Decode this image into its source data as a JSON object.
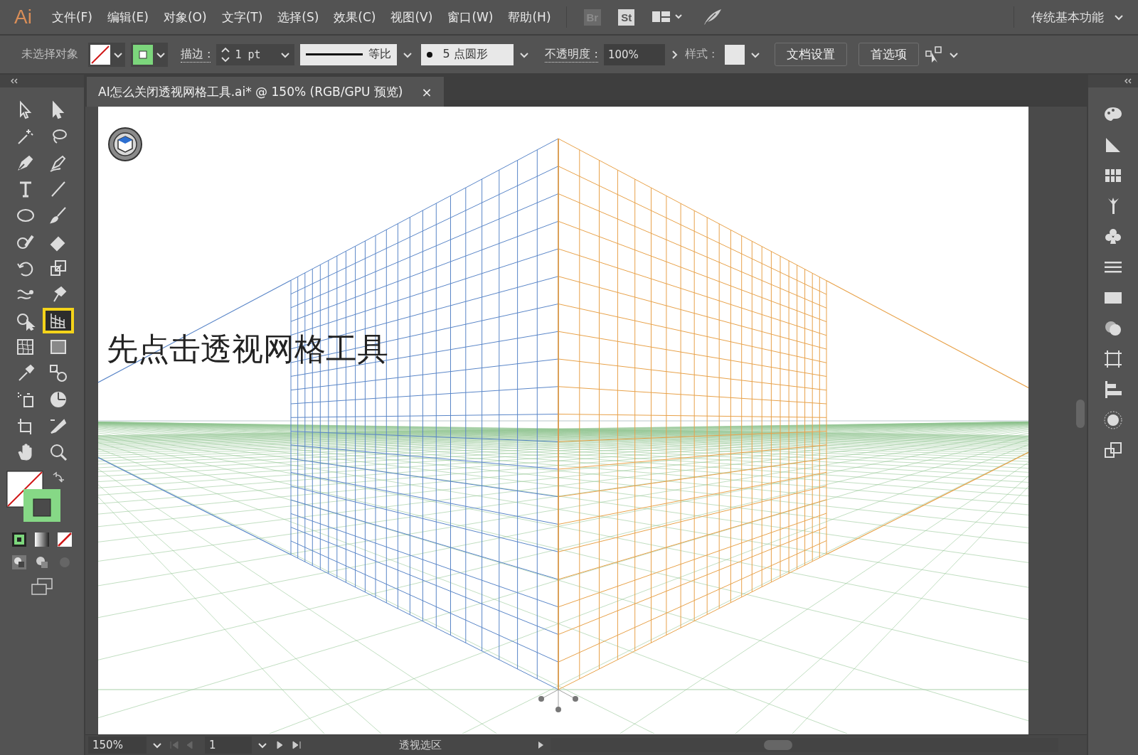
{
  "app_logo": "Ai",
  "menu": [
    "文件(F)",
    "编辑(E)",
    "对象(O)",
    "文字(T)",
    "选择(S)",
    "效果(C)",
    "视图(V)",
    "窗口(W)",
    "帮助(H)"
  ],
  "bridge_button": "Br",
  "stock_button": "St",
  "workspace": "传统基本功能",
  "control_bar": {
    "selection": "未选择对象",
    "stroke_label": "描边 :",
    "stroke_weight": "1 pt",
    "stroke_profile": "等比",
    "brush": "5 点圆形",
    "opacity_label": "不透明度 :",
    "opacity": "100%",
    "style_label": "样式 :",
    "buttons": [
      "文档设置",
      "首选项"
    ]
  },
  "document_tab": {
    "title": "AI怎么关闭透视网格工具.ai* @ 150% (RGB/GPU 预览)",
    "close": "×"
  },
  "tools": [
    {
      "kind": "selection",
      "selected": false
    },
    {
      "kind": "direct",
      "selected": false
    },
    {
      "kind": "wand",
      "selected": false
    },
    {
      "kind": "lasso",
      "selected": false
    },
    {
      "kind": "pen",
      "selected": false
    },
    {
      "kind": "curvature",
      "selected": false
    },
    {
      "kind": "type",
      "selected": false
    },
    {
      "kind": "line",
      "selected": false
    },
    {
      "kind": "ellipse",
      "selected": false
    },
    {
      "kind": "brush",
      "selected": false
    },
    {
      "kind": "shaper",
      "selected": false
    },
    {
      "kind": "eraser",
      "selected": false
    },
    {
      "kind": "rotate",
      "selected": false
    },
    {
      "kind": "scale",
      "selected": false
    },
    {
      "kind": "width",
      "selected": false
    },
    {
      "kind": "puppet",
      "selected": false
    },
    {
      "kind": "shapebuilder",
      "selected": false
    },
    {
      "kind": "perspective",
      "selected": true
    },
    {
      "kind": "mesh",
      "selected": false
    },
    {
      "kind": "gradient",
      "selected": false
    },
    {
      "kind": "eyedropper",
      "selected": false
    },
    {
      "kind": "blend",
      "selected": false
    },
    {
      "kind": "sprayer",
      "selected": false
    },
    {
      "kind": "graph",
      "selected": false
    },
    {
      "kind": "artboard",
      "selected": false
    },
    {
      "kind": "slice",
      "selected": false
    },
    {
      "kind": "hand",
      "selected": false
    },
    {
      "kind": "zoom",
      "selected": false
    }
  ],
  "annotation": "先点击透视网格工具",
  "status_bar": {
    "zoom": "150%",
    "artboard": "1",
    "info": "透视选区"
  }
}
